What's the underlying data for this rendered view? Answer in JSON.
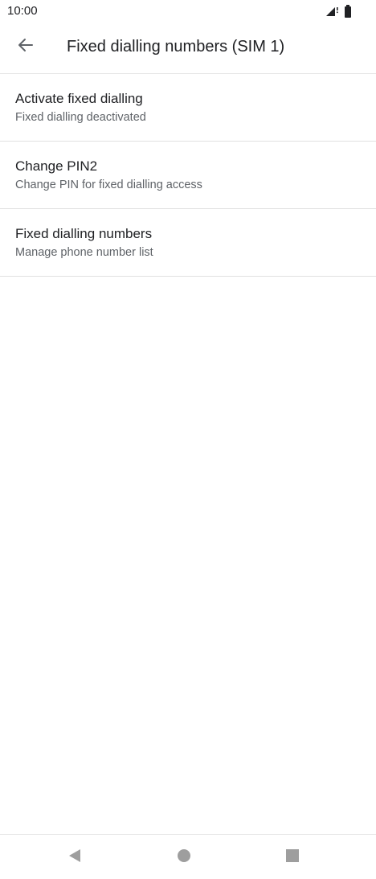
{
  "status_bar": {
    "time": "10:00",
    "icons": [
      "signal-icon",
      "battery-icon"
    ]
  },
  "app_bar": {
    "back_icon": "arrow-back-icon",
    "title": "Fixed dialling numbers (SIM 1)"
  },
  "settings": [
    {
      "title": "Activate fixed dialling",
      "subtitle": "Fixed dialling deactivated"
    },
    {
      "title": "Change PIN2",
      "subtitle": "Change PIN for fixed dialling access"
    },
    {
      "title": "Fixed dialling numbers",
      "subtitle": "Manage phone number list"
    }
  ],
  "nav_bar": {
    "icons": [
      "nav-back-icon",
      "nav-home-icon",
      "nav-recents-icon"
    ]
  },
  "colors": {
    "background": "#ffffff",
    "primary_text": "#202124",
    "secondary_text": "#5f6368",
    "divider": "#e0e0e0",
    "nav_icon": "#9e9e9e"
  }
}
